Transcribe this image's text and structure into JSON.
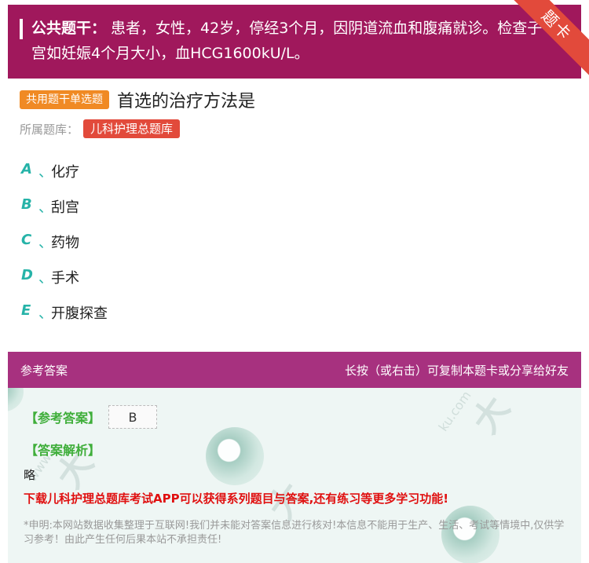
{
  "stem": {
    "label": "公共题干：",
    "text": "患者，女性，42岁，停经3个月，因阴道流血和腹痛就诊。检查子宫如妊娠4个月大小，血HCG1600kU/L。"
  },
  "ribbon": {
    "text": "题卡"
  },
  "question": {
    "type_badge": "共用题干单选题",
    "title": "首选的治疗方法是"
  },
  "bank": {
    "label": "所属题库：",
    "name": "儿科护理总题库"
  },
  "options": [
    {
      "letter": "A",
      "sep": "、",
      "text": "化疗"
    },
    {
      "letter": "B",
      "sep": "、",
      "text": "刮宫"
    },
    {
      "letter": "C",
      "sep": "、",
      "text": "药物"
    },
    {
      "letter": "D",
      "sep": "、",
      "text": "手术"
    },
    {
      "letter": "E",
      "sep": "、",
      "text": "开腹探查"
    }
  ],
  "answer_section": {
    "header_left": "参考答案",
    "header_right": "长按（或右击）可复制本题卡或分享给好友",
    "ref_label": "【参考答案】",
    "ref_value": "B",
    "analysis_label": "【答案解析】",
    "analysis_text": "略",
    "promo": "下载儿科护理总题库考试APP可以获得系列题目与答案,还有练习等更多学习功能!",
    "disclaimer": "*申明:本网站数据收集整理于互联网!我们并未能对答案信息进行核对!本信息不能用于生产、生活、考试等情境中,仅供学习参考！由此产生任何后果本站不承担责任!"
  },
  "colors": {
    "stem_bg": "#a0185c",
    "answer_header_bg": "#a7317f",
    "type_badge": "#f08a24",
    "bank_badge": "#e24a3b",
    "option_letter": "#26b3a8",
    "answer_green": "#3fae3a",
    "promo_red": "#e01010"
  }
}
